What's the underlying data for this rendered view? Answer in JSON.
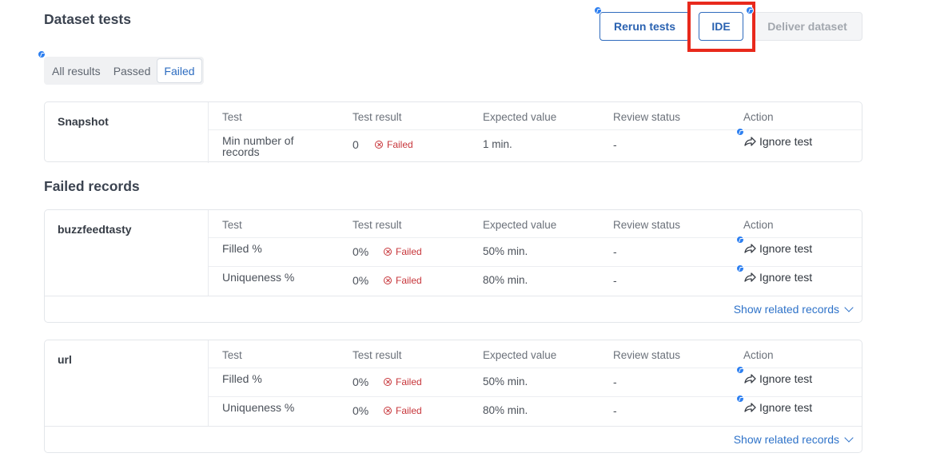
{
  "header": {
    "title": "Dataset tests",
    "rerun_label": "Rerun tests",
    "ide_label": "IDE",
    "deliver_label": "Deliver dataset"
  },
  "filters": {
    "items": [
      "All results",
      "Passed",
      "Failed"
    ],
    "active": "Failed"
  },
  "columns": [
    "Test",
    "Test result",
    "Expected value",
    "Review status",
    "Action"
  ],
  "snapshot": {
    "name": "Snapshot",
    "rows": [
      {
        "test": "Min number of records",
        "result": "0",
        "status": "Failed",
        "expected": "1 min.",
        "review": "-",
        "action": "Ignore test"
      }
    ]
  },
  "failed_records_title": "Failed records",
  "groups": [
    {
      "name": "buzzfeedtasty",
      "rows": [
        {
          "test": "Filled %",
          "result": "0%",
          "status": "Failed",
          "expected": "50% min.",
          "review": "-",
          "action": "Ignore test"
        },
        {
          "test": "Uniqueness %",
          "result": "0%",
          "status": "Failed",
          "expected": "80% min.",
          "review": "-",
          "action": "Ignore test"
        }
      ],
      "show_related": "Show related records"
    },
    {
      "name": "url",
      "rows": [
        {
          "test": "Filled %",
          "result": "0%",
          "status": "Failed",
          "expected": "50% min.",
          "review": "-",
          "action": "Ignore test"
        },
        {
          "test": "Uniqueness %",
          "result": "0%",
          "status": "Failed",
          "expected": "80% min.",
          "review": "-",
          "action": "Ignore test"
        }
      ],
      "show_related": "Show related records"
    }
  ],
  "colors": {
    "accent": "#2a62b1",
    "failed": "#c7353a",
    "highlight": "#e8291c",
    "marker": "#2d7ff0"
  }
}
